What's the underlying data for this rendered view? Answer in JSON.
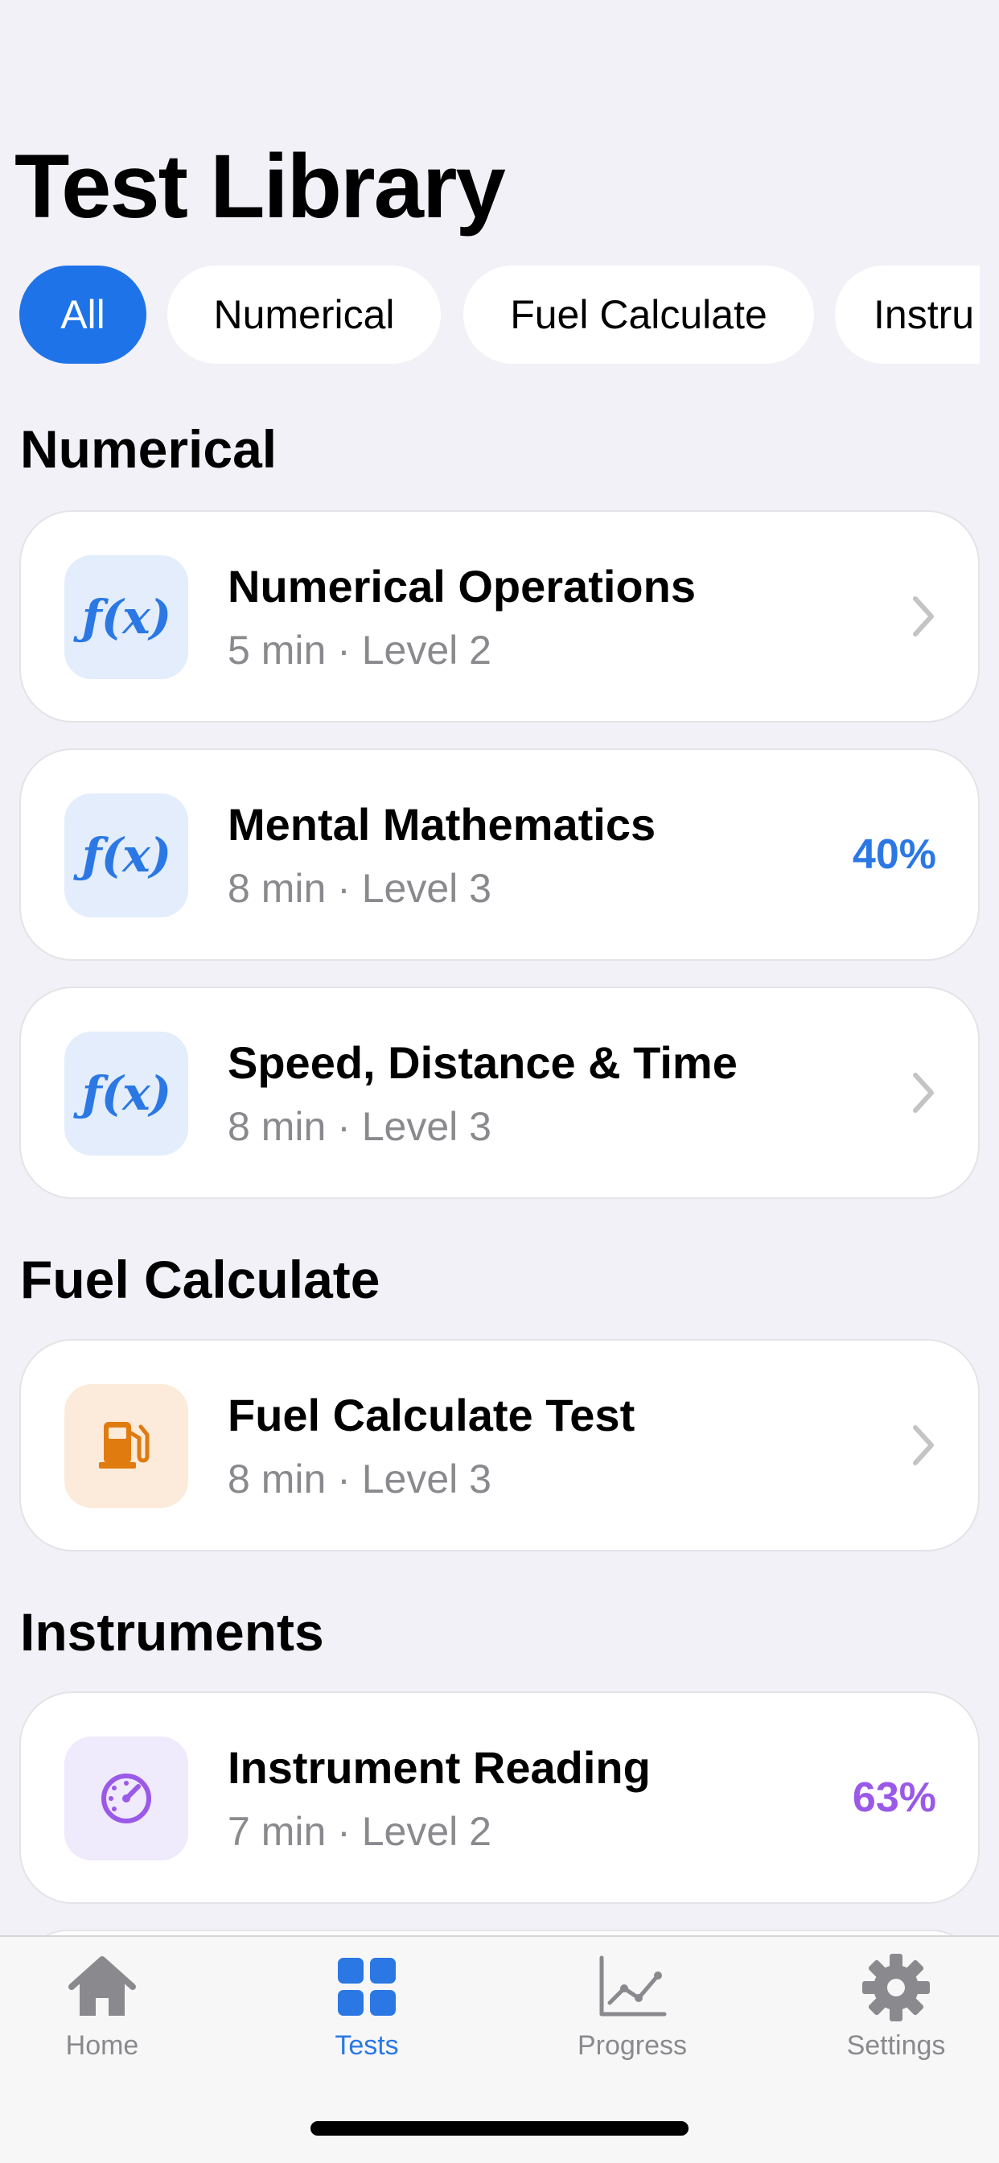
{
  "header": {
    "title": "Test Library"
  },
  "filters": [
    {
      "label": "All",
      "active": true
    },
    {
      "label": "Numerical",
      "active": false
    },
    {
      "label": "Fuel Calculate",
      "active": false
    },
    {
      "label": "Instru",
      "active": false
    }
  ],
  "sections": [
    {
      "title": "Numerical",
      "items": [
        {
          "name": "Numerical Operations",
          "meta": "5 min · Level 2",
          "icon": "function-icon",
          "trailing": "chevron"
        },
        {
          "name": "Mental Mathematics",
          "meta": "8 min · Level 3",
          "icon": "function-icon",
          "trailing": "40%"
        },
        {
          "name": "Speed, Distance & Time",
          "meta": "8 min · Level 3",
          "icon": "function-icon",
          "trailing": "chevron"
        }
      ]
    },
    {
      "title": "Fuel Calculate",
      "items": [
        {
          "name": "Fuel Calculate Test",
          "meta": "8 min · Level 3",
          "icon": "fuel-pump-icon",
          "trailing": "chevron"
        }
      ]
    },
    {
      "title": "Instruments",
      "items": [
        {
          "name": "Instrument Reading",
          "meta": "7 min · Level 2",
          "icon": "gauge-icon",
          "trailing": "63%"
        }
      ]
    }
  ],
  "icon_text": {
    "function": "ƒ(x)"
  },
  "tabbar": {
    "tabs": [
      {
        "label": "Home",
        "icon": "house-icon",
        "active": false
      },
      {
        "label": "Tests",
        "icon": "grid-icon",
        "active": true
      },
      {
        "label": "Progress",
        "icon": "chart-line-icon",
        "active": false
      },
      {
        "label": "Settings",
        "icon": "gear-icon",
        "active": false
      }
    ]
  },
  "colors": {
    "accent": "#1f73e8",
    "background": "#f2f1f7",
    "numerical": "#2b78e4",
    "fuel": "#e07b10",
    "instruments": "#9a59e8",
    "secondary_text": "#8a8a8e"
  }
}
